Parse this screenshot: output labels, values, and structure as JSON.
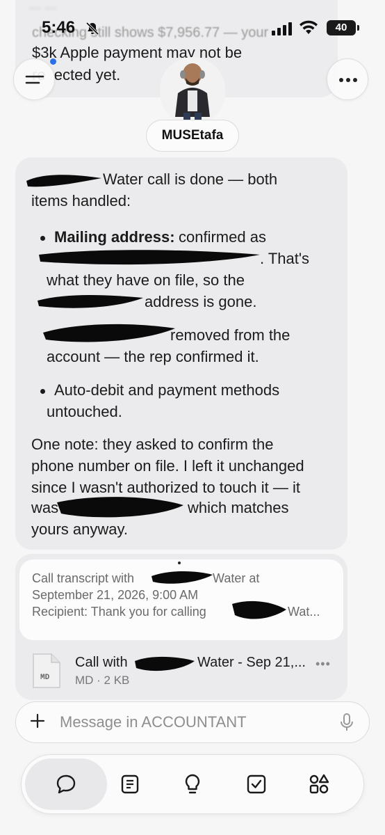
{
  "status_bar": {
    "time": "5:46",
    "battery": "40"
  },
  "previous_message": {
    "line_top": "... ...",
    "line1": "checking still shows $7,956.77 — your",
    "line2": "$3k Apple payment may not be",
    "line3": "re  ected yet."
  },
  "agent": {
    "name": "MUSEtafa"
  },
  "message": {
    "intro_1": "Water call is done — both",
    "intro_2": "items handled:",
    "bullet1_label": "Mailing address:",
    "bullet1_rest": " confirmed as",
    "bullet1_l2": ". That's",
    "bullet1_l3": "what they have on file, so the",
    "bullet1_l4": "address is gone.",
    "bullet2_l1": "removed from the",
    "bullet2_l2": "account — the rep confirmed it.",
    "bullet3_l1": "Auto-debit and payment methods",
    "bullet3_l2": "untouched.",
    "note_1": "One note: they asked to confirm the",
    "note_2": "phone number on file. I left it unchanged",
    "note_3": "since I wasn't authorized to touch it — it",
    "note_4a": "was",
    "note_4b": "which matches",
    "note_5": "yours anyway."
  },
  "attachment": {
    "transcript_1a": "Call transcript with",
    "transcript_1b": "Water at",
    "transcript_2": "September 21, 2026, 9:00 AM",
    "transcript_3a": "Recipient: Thank you for calling",
    "transcript_3b": "Wat...",
    "file_badge": "MD",
    "file_title_a": "Call with",
    "file_title_b": "Water - Sep 21,...",
    "file_meta": "MD · 2 KB"
  },
  "composer": {
    "placeholder": "Message in ACCOUNTANT"
  },
  "nav": {
    "items": [
      "chat-icon",
      "notes-icon",
      "lightbulb-icon",
      "checkbox-icon",
      "apps-icon"
    ]
  },
  "colors": {
    "background": "#f6f6f7",
    "bubble": "#ebebed",
    "accent_dot": "#2c6fe8",
    "redaction": "#0a0a0a"
  }
}
